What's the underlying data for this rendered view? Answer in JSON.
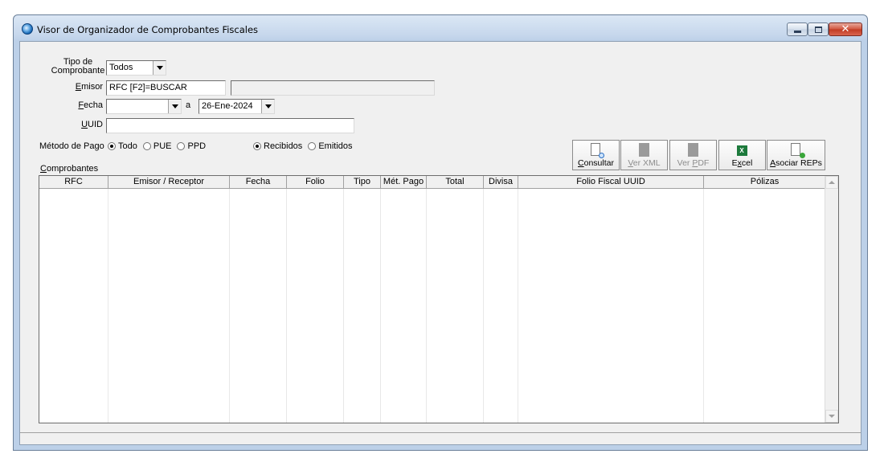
{
  "window": {
    "title": "Visor de Organizador de Comprobantes Fiscales",
    "min_glyph": "—",
    "max_glyph": "□",
    "close_glyph": "✕"
  },
  "filters": {
    "tipo_label_1": "Tipo de",
    "tipo_label_2": "Comprobante",
    "tipo_value": "Todos",
    "emisor_label_u": "E",
    "emisor_label_rest": "misor",
    "emisor_value": "RFC [F2]=BUSCAR",
    "emisor_name_value": "",
    "fecha_label_u": "F",
    "fecha_label_rest": "echa",
    "fecha_from_value": "",
    "fecha_sep": "a",
    "fecha_to_value": "26-Ene-2024",
    "uuid_label_u": "U",
    "uuid_label_rest": "UID",
    "uuid_value": "",
    "metodo_label": "Método de Pago",
    "metodo_options": [
      "Todo",
      "PUE",
      "PPD"
    ],
    "metodo_selected": 0,
    "direccion_options": [
      "Recibidos",
      "Emitidos"
    ],
    "direccion_selected": 0
  },
  "toolbar": {
    "consultar_u": "C",
    "consultar_rest": "onsultar",
    "verxml_a": "V",
    "verxml_b": "er XML",
    "verpdf_a": "Ver ",
    "verpdf_u": "P",
    "verpdf_b": "DF",
    "excel_a": "E",
    "excel_u": "x",
    "excel_b": "cel",
    "asociar_u": "A",
    "asociar_rest": "sociar REPs",
    "excel_icon_text": "X"
  },
  "grid": {
    "group_label_u": "C",
    "group_label_rest": "omprobantes",
    "columns": [
      "RFC",
      "Emisor / Receptor",
      "Fecha",
      "Folio",
      "Tipo",
      "Mét. Pago",
      "Total",
      "Divisa",
      "Folio Fiscal UUID",
      "Pólizas"
    ],
    "rows": []
  },
  "icons": {
    "app": "app-globe-icon",
    "consultar": "document-search-icon",
    "verxml": "document-icon",
    "verpdf": "document-icon",
    "excel": "excel-icon",
    "asociar": "document-add-icon"
  }
}
